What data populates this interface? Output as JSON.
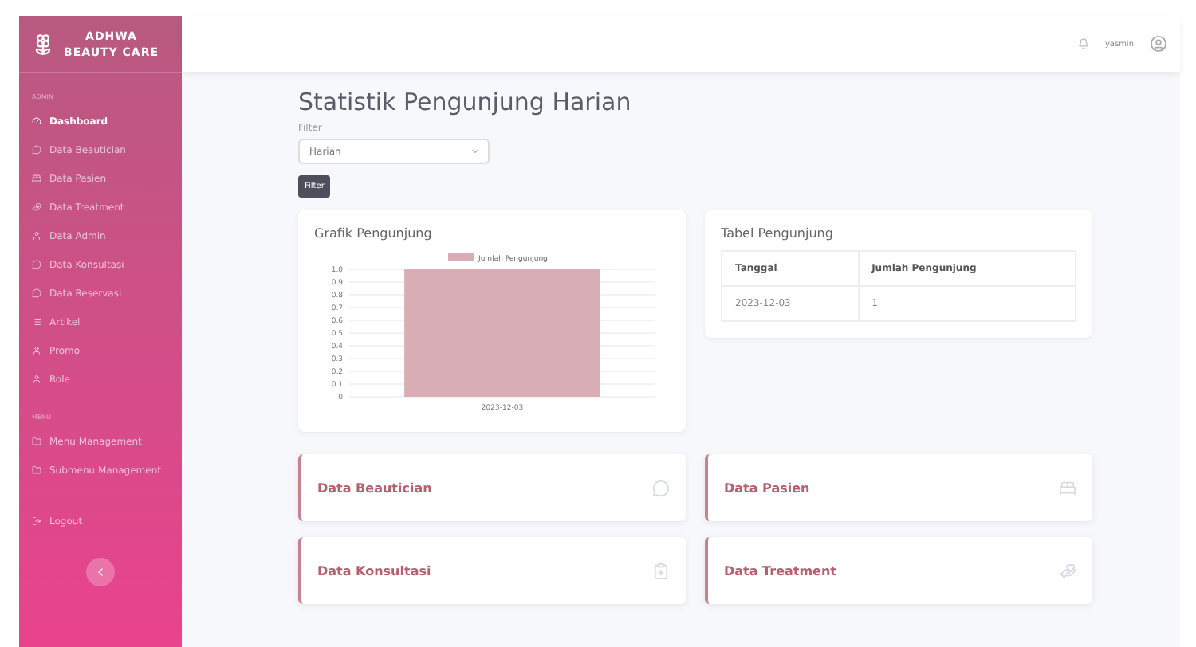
{
  "brand": {
    "line_1": "ADHWA",
    "line_2": "BEAUTY CARE"
  },
  "sidebar": {
    "sections": [
      {
        "heading": "ADMIN",
        "items": [
          {
            "label": "Dashboard",
            "selected": true
          },
          {
            "label": "Data Beautician",
            "selected": false
          },
          {
            "label": "Data Pasien",
            "selected": false
          },
          {
            "label": "Data Treatment",
            "selected": false
          },
          {
            "label": "Data Admin",
            "selected": false
          },
          {
            "label": "Data Konsultasi",
            "selected": false
          },
          {
            "label": "Data Reservasi",
            "selected": false
          },
          {
            "label": "Artikel",
            "selected": false
          },
          {
            "label": "Promo",
            "selected": false
          },
          {
            "label": "Role",
            "selected": false
          }
        ]
      },
      {
        "heading": "MENU",
        "items": [
          {
            "label": "Menu Management",
            "selected": false
          },
          {
            "label": "Submenu Management",
            "selected": false
          }
        ]
      }
    ],
    "logout": "Logout"
  },
  "topbar": {
    "user": "yasmin"
  },
  "page": {
    "title": "Statistik Pengunjung Harian",
    "filter_label": "Filter",
    "filter_value": "Harian",
    "filter_button": "Filter"
  },
  "chart_card": {
    "title": "Grafik Pengunjung",
    "chart_data": {
      "type": "bar",
      "grid": true,
      "categories": [
        "2023-12-03"
      ],
      "series": [
        {
          "name": "Jumlah Pengunjung",
          "color": "#d9adb6",
          "values": [
            1
          ]
        }
      ],
      "ylim": [
        0,
        1
      ],
      "yticks": [
        {
          "value": 0,
          "label": "0"
        },
        {
          "value": 0.1,
          "label": "0.1"
        },
        {
          "value": 0.2,
          "label": "0.2"
        },
        {
          "value": 0.3,
          "label": "0.3"
        },
        {
          "value": 0.4,
          "label": "0.4"
        },
        {
          "value": 0.5,
          "label": "0.5"
        },
        {
          "value": 0.6,
          "label": "0.6"
        },
        {
          "value": 0.7,
          "label": "0.7"
        },
        {
          "value": 0.8,
          "label": "0.8"
        },
        {
          "value": 0.9,
          "label": "0.9"
        },
        {
          "value": 1,
          "label": "1.0"
        }
      ]
    }
  },
  "table_card": {
    "title": "Tabel Pengunjung",
    "columns": [
      "Tanggal",
      "Jumlah Pengunjung"
    ],
    "rows": [
      [
        "2023-12-03",
        "1"
      ]
    ]
  },
  "stat_cards": [
    {
      "label": "Data Beautician"
    },
    {
      "label": "Data Pasien"
    },
    {
      "label": "Data Konsultasi"
    },
    {
      "label": "Data Treatment"
    }
  ]
}
